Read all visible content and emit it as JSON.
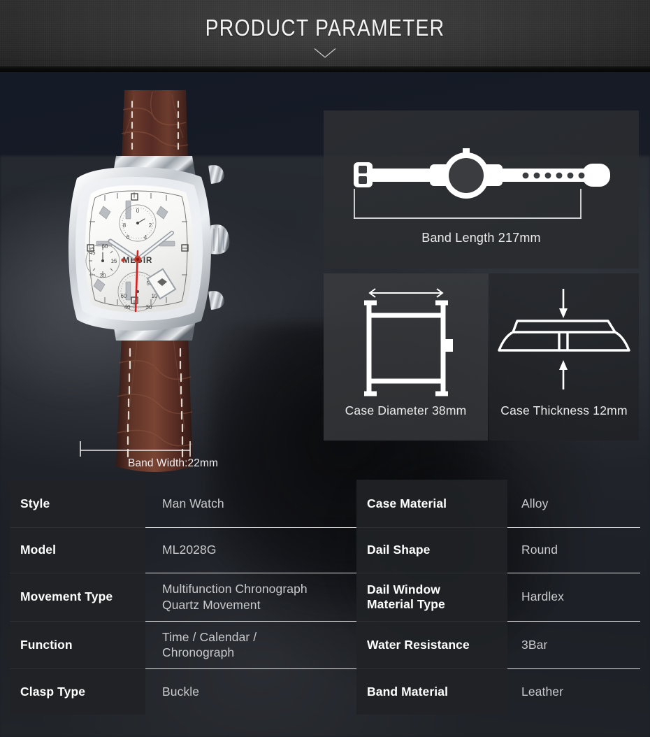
{
  "header": {
    "title": "PRODUCT PARAMETER",
    "divider_icon": "chevron-down-divider"
  },
  "product_photo": {
    "brand_text": "MEGIR",
    "alt_name": "megir-square-chronograph-watch",
    "case_color": "#d8dade",
    "dial_color": "#f2f2f0",
    "strap_color": "#5a3028",
    "second_hand_color": "#d81f1f"
  },
  "diagrams": {
    "band_length": {
      "caption": "Band Length 217mm",
      "icon": "watch-band-flat-icon",
      "dimension_icon": "dimension-bracket-icon"
    },
    "case_diameter": {
      "caption": "Case Diameter 38mm",
      "icon": "watch-case-front-icon",
      "dimension_icon": "dimension-arrow-horizontal-icon"
    },
    "case_thickness": {
      "caption": "Case Thickness 12mm",
      "icon": "watch-case-side-icon",
      "dimension_icon": "dimension-arrows-vertical-icon"
    },
    "band_width": {
      "caption": "Band Width:22mm",
      "dimension_icon": "dimension-bracket-icon"
    }
  },
  "spec_table": {
    "rows": [
      {
        "left_label": "Style",
        "left_value": "Man Watch",
        "right_label": "Case Material",
        "right_value": "Alloy"
      },
      {
        "left_label": "Model",
        "left_value": "ML2028G",
        "right_label": "Dail Shape",
        "right_value": "Round"
      },
      {
        "left_label": "Movement Type",
        "left_value": "Multifunction Chronograph\nQuartz Movement",
        "right_label": "Dail Window\nMaterial Type",
        "right_value": "Hardlex"
      },
      {
        "left_label": "Function",
        "left_value": "Time  / Calendar /\nChronograph",
        "right_label": "Water Resistance",
        "right_value": "3Bar"
      },
      {
        "left_label": "Clasp Type",
        "left_value": "Buckle",
        "right_label": "Band Material",
        "right_value": "Leather"
      }
    ]
  }
}
